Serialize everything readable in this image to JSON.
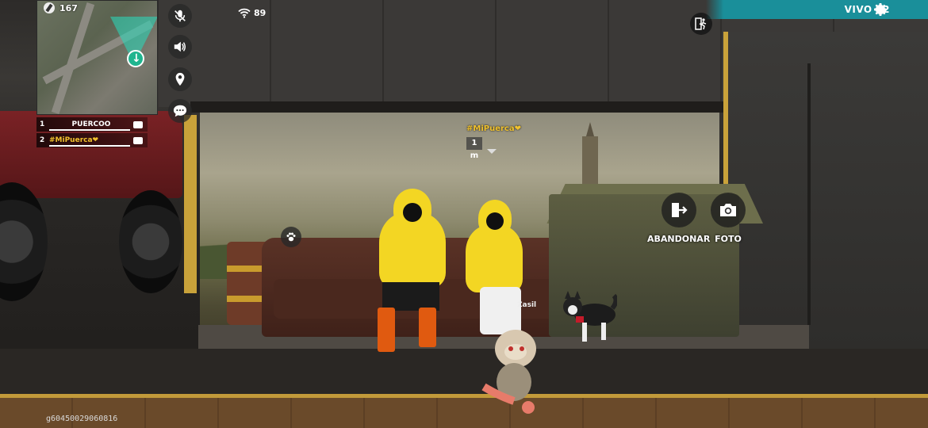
{
  "hud": {
    "alive_count": "167",
    "ping": "89",
    "live_label": "VIVO 12",
    "player_uid": "g60450029060816"
  },
  "team": [
    {
      "index": "1",
      "name": "PUERCOO"
    },
    {
      "index": "2",
      "name": "#MiPuerca❤"
    }
  ],
  "teammate_tag": {
    "name": "#MiPuerca❤",
    "distance": "1 m"
  },
  "character_label": "Zasil",
  "actions": {
    "leave_label": "ABANDONAR",
    "photo_label": "FOTO"
  },
  "colors": {
    "accent_teal": "#1a8f9a",
    "hoodie_yellow": "#f3d623",
    "tag_gold": "#f1c22e"
  },
  "icons": {
    "side": [
      "microphone-muted-icon",
      "speaker-icon",
      "location-pin-icon",
      "chat-icon"
    ],
    "top": [
      "wifi-icon",
      "exit-run-icon",
      "gear-icon"
    ],
    "actions": [
      "leave-door-icon",
      "camera-icon",
      "paw-icon"
    ]
  }
}
